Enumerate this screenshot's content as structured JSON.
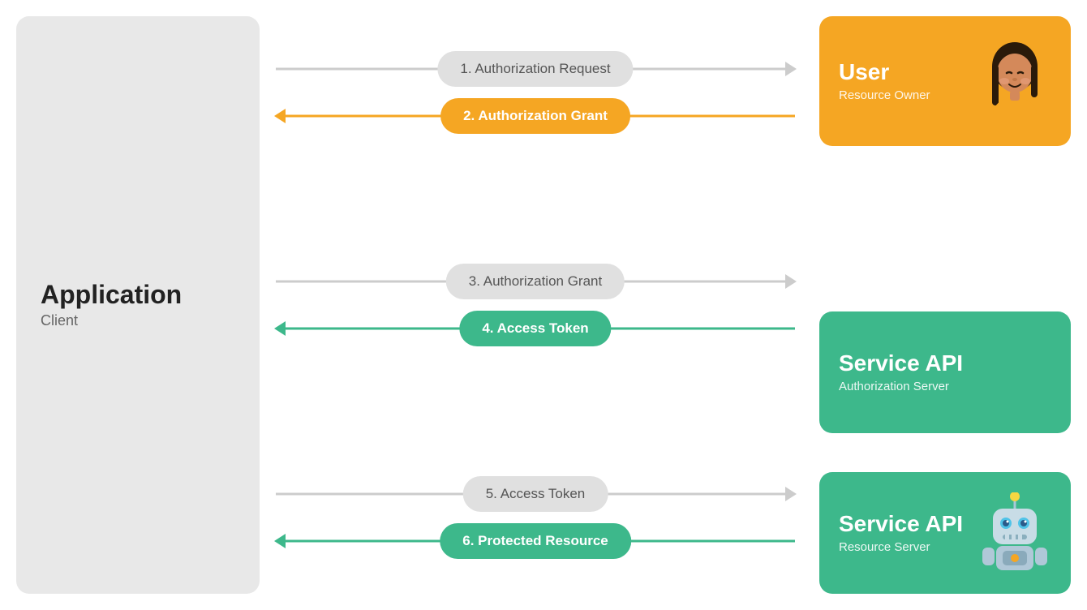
{
  "client": {
    "title": "Application",
    "subtitle": "Client"
  },
  "arrows": [
    {
      "id": "arrow1",
      "label": "1. Authorization Request",
      "type": "right",
      "style": "gray"
    },
    {
      "id": "arrow2",
      "label": "2. Authorization Grant",
      "type": "left",
      "style": "orange"
    },
    {
      "id": "arrow3",
      "label": "3. Authorization Grant",
      "type": "right",
      "style": "gray"
    },
    {
      "id": "arrow4",
      "label": "4. Access Token",
      "type": "left",
      "style": "green"
    },
    {
      "id": "arrow5",
      "label": "5. Access Token",
      "type": "right",
      "style": "gray"
    },
    {
      "id": "arrow6",
      "label": "6. Protected Resource",
      "type": "left",
      "style": "green"
    }
  ],
  "cards": [
    {
      "id": "card-user",
      "title": "User",
      "subtitle": "Resource Owner",
      "style": "orange",
      "avatar": "user"
    },
    {
      "id": "card-auth-server",
      "title": "Service API",
      "subtitle": "Authorization Server",
      "style": "green",
      "avatar": "none"
    },
    {
      "id": "card-resource-server",
      "title": "Service API",
      "subtitle": "Resource Server",
      "style": "green",
      "avatar": "robot"
    }
  ],
  "colors": {
    "gray_pill": "#e0e0e0",
    "gray_text": "#555555",
    "orange": "#f5a623",
    "green": "#3db88b",
    "white": "#ffffff",
    "client_bg": "#e8e8e8",
    "client_title": "#222222",
    "client_subtitle": "#666666"
  }
}
